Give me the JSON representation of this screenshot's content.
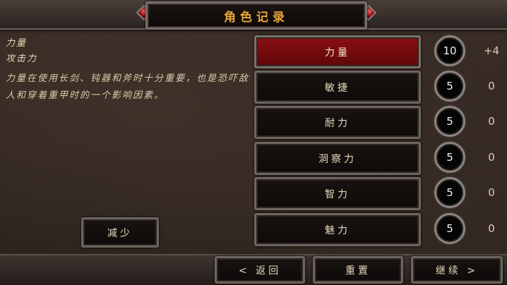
{
  "header": {
    "title": "角色记录"
  },
  "description": {
    "name": "力量",
    "subtitle": "攻击力",
    "body": "力量在使用长剑、钝器和斧时十分重要，也是恐吓敌人和穿着重甲时的一个影响因素。"
  },
  "attributes": [
    {
      "label": "力量",
      "value": "10",
      "bonus": "+4",
      "selected": true
    },
    {
      "label": "敏捷",
      "value": "5",
      "bonus": "0"
    },
    {
      "label": "耐力",
      "value": "5",
      "bonus": "0"
    },
    {
      "label": "洞察力",
      "value": "5",
      "bonus": "0"
    },
    {
      "label": "智力",
      "value": "5",
      "bonus": "0"
    },
    {
      "label": "魅力",
      "value": "5",
      "bonus": "0"
    }
  ],
  "buttons": {
    "decrease": "减少",
    "back": "< 返回",
    "reset": "重置",
    "continue": "继续 >"
  },
  "colors": {
    "accent": "#e8a63a",
    "selected": "#8a0f12"
  }
}
